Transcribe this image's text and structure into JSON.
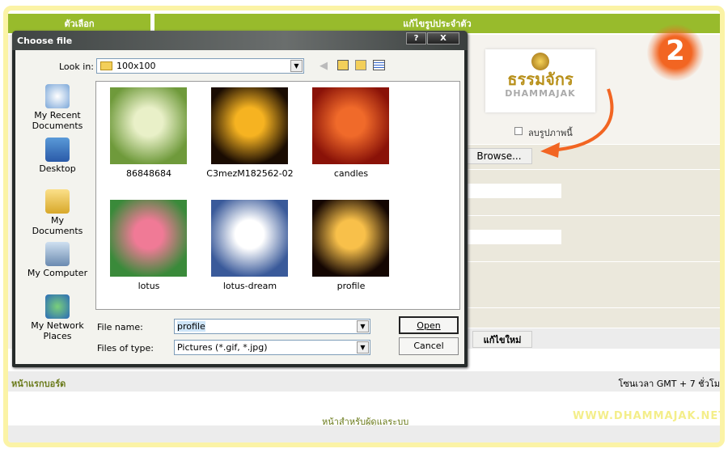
{
  "header": {
    "left_label": "ตัวเลือก",
    "right_label": "แก้ไขรูปประจำตัว"
  },
  "profile": {
    "logo_text": "ธรรมจักร",
    "logo_sub": "DHAMMAJAK",
    "delete_checkbox_label": "ลบรูปภาพนี้",
    "delete_checked": false,
    "browse_label": "Browse...",
    "submit_label": "แก้ไขใหม่"
  },
  "step_badge": "2",
  "dialog": {
    "title": "Choose file",
    "help": "?",
    "close": "X",
    "look_in_label": "Look in:",
    "look_in_value": "100x100",
    "places": [
      "My Recent Documents",
      "Desktop",
      "My Documents",
      "My Computer",
      "My Network Places"
    ],
    "files": [
      {
        "name": "86848684",
        "colors": [
          "#e9f0c8",
          "#6f9a3b"
        ]
      },
      {
        "name": "C3mezM182562-02",
        "colors": [
          "#f6b321",
          "#1a0c02"
        ]
      },
      {
        "name": "candles",
        "colors": [
          "#f06a2a",
          "#8a1208"
        ]
      },
      {
        "name": "lotus",
        "colors": [
          "#f07a96",
          "#3a8a3a"
        ]
      },
      {
        "name": "lotus-dream",
        "colors": [
          "#ffffff",
          "#3a5a9a"
        ]
      },
      {
        "name": "profile",
        "colors": [
          "#f8c04a",
          "#140602"
        ]
      }
    ],
    "file_name_label": "File name:",
    "file_name_value": "profile",
    "file_type_label": "Files of type:",
    "file_type_value": "Pictures (*.gif, *.jpg)",
    "open_label": "Open",
    "cancel_label": "Cancel"
  },
  "footer": {
    "board_home": "หน้าแรกบอร์ด",
    "timezone": "โซนเวลา GMT + 7 ชั่วโม",
    "admin_link": "หน้าสำหรับผู้ดูแลระบบ",
    "watermark": "WWW.DHAMMAJAK.NET"
  },
  "colors": {
    "accent": "#98bb2c",
    "frame": "#fbf3a6",
    "arrow": "#f26522"
  }
}
